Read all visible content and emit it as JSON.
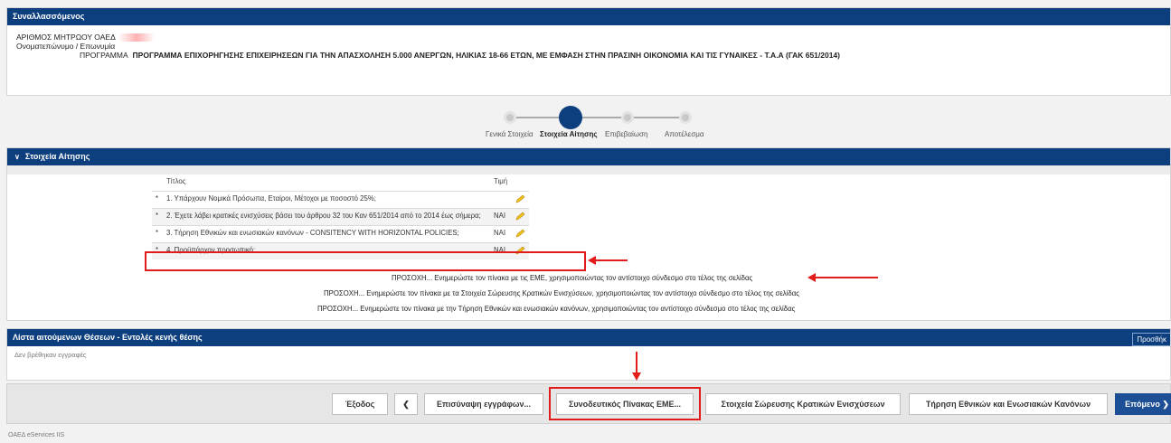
{
  "party": {
    "header": "Συναλλασσόμενος",
    "registry_label": "ΑΡΙΘΜΟΣ ΜΗΤΡΩΟΥ ΟΑΕΔ",
    "name_label": "Ονοματεπώνυμο / Επωνυμία",
    "program_label": "ΠΡΟΓΡΑΜΜΑ",
    "program_value": "ΠΡΟΓΡΑΜΜΑ ΕΠΙΧΟΡΗΓΗΣΗΣ ΕΠΙΧΕΙΡΗΣΕΩΝ ΓΙΑ ΤΗΝ ΑΠΑΣΧΟΛΗΣΗ 5.000 ΑΝΕΡΓΩΝ, ΗΛΙΚΙΑΣ 18-66 ΕΤΩΝ, ΜΕ ΕΜΦΑΣΗ ΣΤΗΝ ΠΡΑΣΙΝΗ ΟΙΚΟΝΟΜΙΑ ΚΑΙ ΤΙΣ ΓΥΝΑΙΚΕΣ - Τ.Α.Α (ΓΑΚ 651/2014)"
  },
  "stepper": {
    "steps": [
      "Γενικά Στοιχεία",
      "Στοιχεία Αίτησης",
      "Επιβεβαίωση",
      "Αποτέλεσμα"
    ],
    "current_index": 1
  },
  "application": {
    "header": "Στοιχεία Αίτησης",
    "columns": {
      "title": "Τίτλος",
      "value": "Τιμή"
    },
    "rows": [
      {
        "marker": "*",
        "title": "1. Υπάρχουν Νομικά Πρόσωπα, Εταίροι, Μέτοχοι με ποσοστό 25%;",
        "value": ""
      },
      {
        "marker": "*",
        "title": "2. Έχετε λάβει κρατικές ενισχύσεις βάσει του άρθρου 32 του Καν 651/2014 από το 2014 έως σήμερα;",
        "value": "ΝΑΙ"
      },
      {
        "marker": "*",
        "title": "3. Τήρηση Εθνικών και ενωσιακών κανόνων - CONSITENCY WITH HORIZONTAL POLICIES;",
        "value": "ΝΑΙ"
      },
      {
        "marker": "*",
        "title": "4. Προϋπάρχον προσωπικό;",
        "value": "ΝΑΙ"
      }
    ],
    "warnings": [
      "ΠΡΟΣΟΧΗ... Ενημερώστε τον πίνακα με τις ΕΜΕ, χρησιμοποιώντας τον αντίστοιχο σύνδεσμο στο τέλος της σελίδας",
      "ΠΡΟΣΟΧΗ... Ενημερώστε τον πίνακα με τα Στοιχεία Σώρευσης Κρατικών Ενισχύσεων, χρησιμοποιώντας τον αντίστοιχο σύνδεσμο στο τέλος της σελίδας",
      "ΠΡΟΣΟΧΗ... Ενημερώστε τον πίνακα με την Τήρηση Εθνικών και ενωσιακών κανόνων, χρησιμοποιώντας τον αντίστοιχο σύνδεσμο στο τέλος της σελίδας"
    ]
  },
  "positions": {
    "header": "Λίστα αιτούμενων Θέσεων - Εντολές κενής θέσης",
    "add_label": "Προσθήκ",
    "empty_text": "Δεν βρέθηκαν εγγραφές"
  },
  "footer": {
    "exit": "Έξοδος",
    "back": "❮",
    "attach": "Επισύναψη εγγράφων...",
    "eme_table": "Συνοδευτικός Πίνακας ΕΜΕ...",
    "state_aid": "Στοιχεία Σώρευσης Κρατικών Ενισχύσεων",
    "compliance": "Τήρηση Εθνικών και Ενωσιακών Κανόνων",
    "next": "Επόμενο ❯"
  },
  "copyright": "ΟΑΕΔ eServices IIS",
  "colors": {
    "header": "#0d3f7f",
    "primary_button": "#1c4f96",
    "annotation": "#e21b1b"
  }
}
